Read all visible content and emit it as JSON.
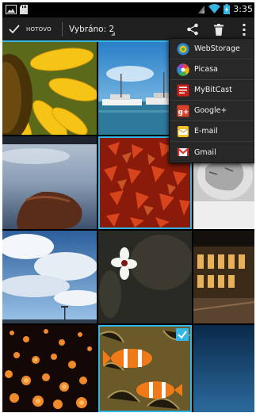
{
  "status_bar": {
    "time": "3:35",
    "left_icons": [
      "image-notification-icon",
      "sd-card-icon"
    ],
    "right_icons": [
      "signal-icon",
      "wifi-icon",
      "battery-icon"
    ]
  },
  "action_bar": {
    "done_label": "HOTOVO",
    "selected_label": "Vybráno: 2",
    "actions": [
      "share-icon",
      "delete-icon",
      "overflow-menu-icon"
    ]
  },
  "share_menu": {
    "items": [
      {
        "label": "WebStorage",
        "icon": "webstorage-icon"
      },
      {
        "label": "Picasa",
        "icon": "picasa-icon"
      },
      {
        "label": "MyBitCast",
        "icon": "mybitcast-icon"
      },
      {
        "label": "Google+",
        "icon": "google-plus-icon"
      },
      {
        "label": "E-mail",
        "icon": "email-icon"
      },
      {
        "label": "Gmail",
        "icon": "gmail-icon"
      }
    ]
  },
  "gallery": {
    "thumbnails": [
      {
        "subject": "sunflower"
      },
      {
        "subject": "harbor-boats"
      },
      {
        "subject": "ocean-rock"
      },
      {
        "subject": "red-leaves"
      },
      {
        "subject": "sleeping-kitten"
      },
      {
        "subject": "cloudy-sky"
      },
      {
        "subject": "white-flower"
      },
      {
        "subject": "night-building"
      },
      {
        "subject": "lanterns"
      },
      {
        "subject": "clownfish"
      },
      {
        "subject": "blue-water"
      }
    ]
  },
  "colors": {
    "accent": "#33b5e5",
    "action_bar_bg": "#202020",
    "menu_bg": "#282828"
  }
}
